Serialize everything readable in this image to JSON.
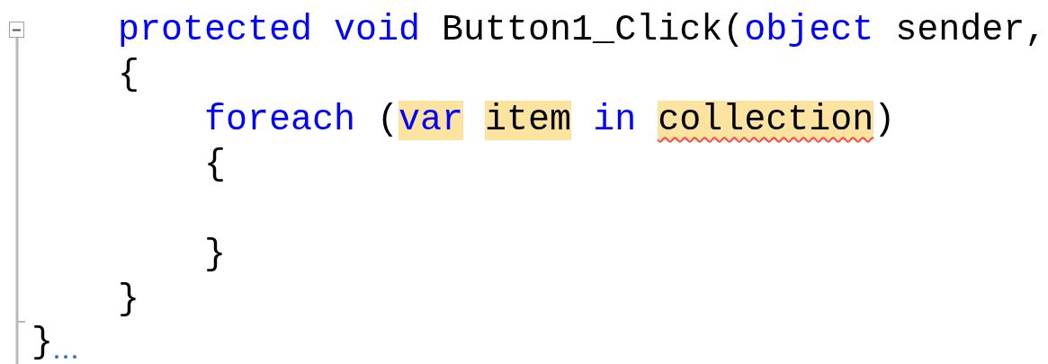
{
  "editor": {
    "fold": {
      "expanded": true
    },
    "lines": [
      {
        "kind": "block",
        "children": [
          {
            "kind": "code",
            "words": [
              {
                "parts": [
                  {
                    "text": "protected",
                    "kind": "keyword"
                  }
                ]
              },
              {
                "parts": [
                  {
                    "text": "void",
                    "kind": "keyword"
                  }
                ]
              },
              {
                "parts": [
                  {
                    "text": "Button1_Click(",
                    "kind": "plain"
                  },
                  {
                    "text": "object",
                    "kind": "keyword"
                  }
                ]
              },
              {
                "parts": [
                  {
                    "text": "sender,",
                    "kind": "plain"
                  }
                ]
              }
            ]
          },
          {
            "kind": "code",
            "words": [
              {
                "parts": [
                  {
                    "text": "{",
                    "kind": "plain"
                  }
                ]
              }
            ]
          },
          {
            "kind": "block",
            "children": [
              {
                "kind": "code",
                "words": [
                  {
                    "parts": [
                      {
                        "text": "foreach",
                        "kind": "keyword"
                      }
                    ]
                  },
                  {
                    "parts": [
                      {
                        "text": "(",
                        "kind": "plain"
                      },
                      {
                        "text": "var",
                        "kind": "keyword",
                        "highlighted": true
                      }
                    ]
                  },
                  {
                    "parts": [
                      {
                        "text": "item",
                        "kind": "plain",
                        "highlighted": true
                      }
                    ]
                  },
                  {
                    "parts": [
                      {
                        "text": "in",
                        "kind": "keyword"
                      }
                    ]
                  },
                  {
                    "parts": [
                      {
                        "text": "collection",
                        "kind": "plain",
                        "highlighted": true,
                        "squiggle": true
                      },
                      {
                        "text": ")",
                        "kind": "plain"
                      }
                    ]
                  }
                ]
              },
              {
                "kind": "code",
                "words": [
                  {
                    "parts": [
                      {
                        "text": "{",
                        "kind": "plain"
                      }
                    ]
                  }
                ]
              },
              {
                "kind": "blank"
              },
              {
                "kind": "code",
                "words": [
                  {
                    "parts": [
                      {
                        "text": "}",
                        "kind": "plain"
                      }
                    ]
                  }
                ]
              }
            ]
          },
          {
            "kind": "code",
            "words": [
              {
                "parts": [
                  {
                    "text": "}",
                    "kind": "plain"
                  }
                ]
              }
            ]
          }
        ]
      },
      {
        "kind": "code",
        "words": [
          {
            "parts": [
              {
                "text": "}",
                "kind": "plain"
              }
            ]
          }
        ]
      }
    ]
  }
}
